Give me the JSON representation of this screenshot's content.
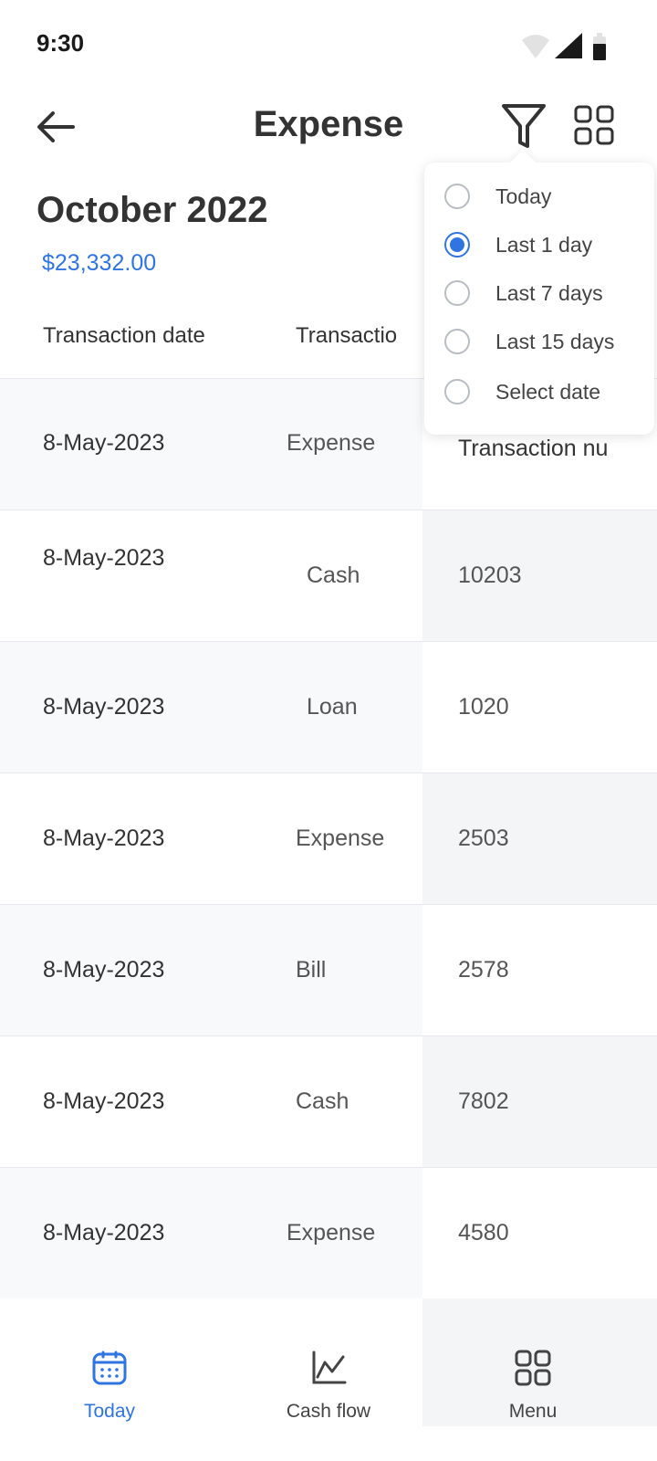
{
  "status_bar": {
    "time": "9:30"
  },
  "app_bar": {
    "title": "Expense"
  },
  "summary": {
    "month": "October 2022",
    "amount": "$23,332.00"
  },
  "table": {
    "headers": [
      "Transaction date",
      "Transactio"
    ],
    "rows": [
      {
        "date": "8-May-2023",
        "type": "Expense",
        "number": "Transaction nu"
      },
      {
        "date": "8-May-2023",
        "type": "Cash",
        "number": "10203"
      },
      {
        "date": "8-May-2023",
        "type": "Loan",
        "number": "1020"
      },
      {
        "date": "8-May-2023",
        "type": "Expense",
        "number": "2503"
      },
      {
        "date": "8-May-2023",
        "type": "Bill",
        "number": "2578"
      },
      {
        "date": "8-May-2023",
        "type": "Cash",
        "number": "7802"
      },
      {
        "date": "8-May-2023",
        "type": "Expense",
        "number": "4580"
      }
    ]
  },
  "filter_menu": {
    "options": [
      {
        "label": "Today",
        "checked": false
      },
      {
        "label": "Last 1 day",
        "checked": true
      },
      {
        "label": "Last 7 days",
        "checked": false
      },
      {
        "label": "Last 15 days",
        "checked": false
      },
      {
        "label": "Select date",
        "checked": false
      }
    ]
  },
  "bottom_nav": {
    "items": [
      {
        "label": "Today",
        "icon": "calendar-icon",
        "active": true
      },
      {
        "label": "Cash flow",
        "icon": "chart-line-icon",
        "active": false
      },
      {
        "label": "Menu",
        "icon": "grid-icon",
        "active": false
      }
    ]
  },
  "colors": {
    "accent": "#2f74e0",
    "row_shade": "#f8f9fb"
  }
}
